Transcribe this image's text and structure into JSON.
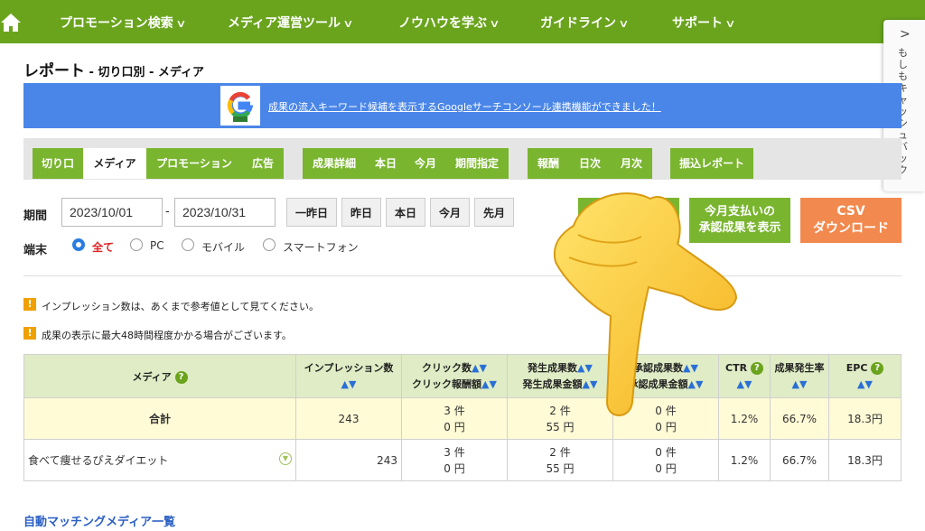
{
  "nav": {
    "items": [
      "プロモーション検索",
      "メディア運営ツール",
      "ノウハウを学ぶ",
      "ガイドライン",
      "サポート"
    ],
    "home_icon": "home-icon"
  },
  "side_tab": {
    "arrow": ">",
    "text": "もしもキャッシュバック"
  },
  "page": {
    "title": "レポート",
    "subtitle": " - 切り口別 - メディア"
  },
  "banner": {
    "text": "成果の流入キーワード候補を表示するGoogleサーチコンソール連携機能ができました！",
    "logo_icon": "google-g-icon"
  },
  "tabs": {
    "group1": [
      "切り口",
      "メディア",
      "プロモーション",
      "広告"
    ],
    "group2": [
      "成果詳細",
      "本日",
      "今月",
      "期間指定"
    ],
    "group3": [
      "報酬",
      "日次",
      "月次"
    ],
    "group4": [
      "振込レポート"
    ]
  },
  "filters": {
    "period_label": "期間",
    "date_from": "2023/10/01",
    "date_to": "2023/10/31",
    "quick": [
      "一昨日",
      "昨日",
      "本日",
      "今月",
      "先月"
    ],
    "device_label": "端末",
    "devices": [
      "全て",
      "PC",
      "モバイル",
      "スマートフォン"
    ],
    "device_selected": "全て"
  },
  "actions": {
    "monthly_label_1": "今月支払いの",
    "monthly_label_2": "承認成果を表示",
    "csv_label_1": "CSV",
    "csv_label_2": "ダウンロード"
  },
  "notices": [
    "インプレッション数は、あくまで参考値として見てください。",
    "成果の表示に最大48時間程度かかる場合がございます。"
  ],
  "table": {
    "headers": {
      "media": "メディア",
      "impressions": "インプレッション数",
      "clicks": "クリック数",
      "click_reward": "クリック報酬額",
      "generated": "発生成果数",
      "generated_amount": "発生成果金額",
      "approved": "承認成果数",
      "approved_amount": "承認成果金額",
      "ctr": "CTR",
      "rate": "成果発生率",
      "epc": "EPC"
    },
    "sort_glyph": "▲▼",
    "total": {
      "label": "合計",
      "impressions": "243",
      "clicks": "3 件",
      "click_reward": "0 円",
      "generated": "2 件",
      "generated_amount": "55 円",
      "approved": "0 件",
      "approved_amount": "0 円",
      "ctr": "1.2%",
      "rate": "66.7%",
      "epc": "18.3円"
    },
    "rows": [
      {
        "media": "食べて痩せるぴえダイエット",
        "impressions": "243",
        "clicks": "3 件",
        "click_reward": "0 円",
        "generated": "2 件",
        "generated_amount": "55 円",
        "approved": "0 件",
        "approved_amount": "0 円",
        "ctr": "1.2%",
        "rate": "66.7%",
        "epc": "18.3円"
      }
    ]
  },
  "footer_link": "自動マッチングメディア一覧",
  "colors": {
    "nav": "#6aa41d",
    "tab": "#7ab530",
    "banner": "#4a86e8",
    "csv": "#f2894e",
    "header": "#dfecc5",
    "total": "#fffbd6"
  }
}
